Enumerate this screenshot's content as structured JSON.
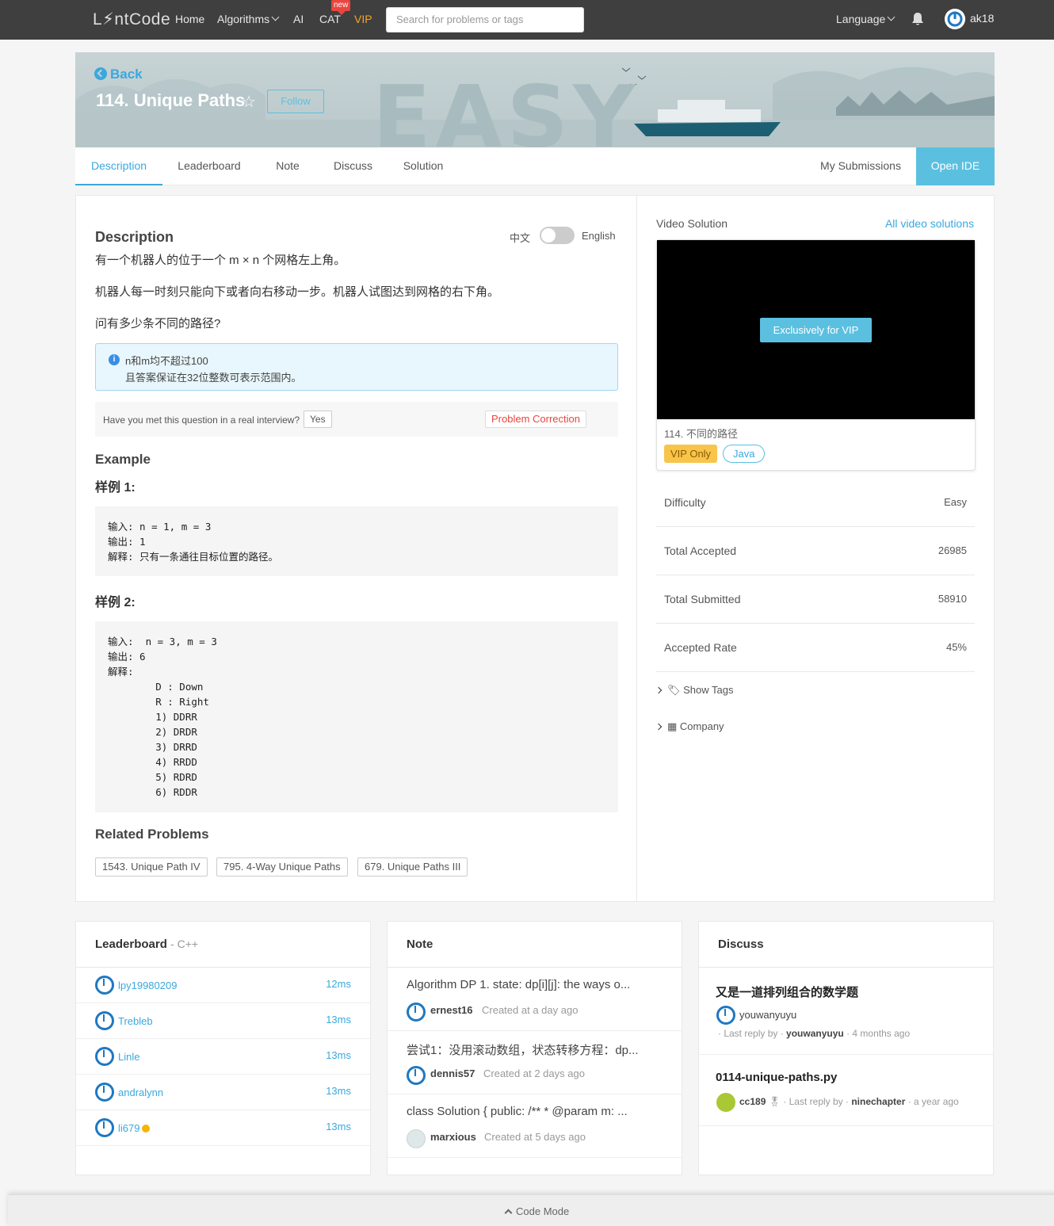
{
  "nav": {
    "logo": "L⚡ntCode",
    "home": "Home",
    "algorithms": "Algorithms",
    "ai": "AI",
    "cat": "CAT",
    "new_badge": "new",
    "vip": "VIP",
    "search_placeholder": "Search for problems or tags",
    "language": "Language",
    "username": "ak18"
  },
  "banner": {
    "back": "Back",
    "title": "114. Unique Paths",
    "follow": "Follow",
    "difficulty_watermark": "EASY"
  },
  "tabs": {
    "description": "Description",
    "leaderboard": "Leaderboard",
    "note": "Note",
    "discuss": "Discuss",
    "solution": "Solution",
    "my_submissions": "My Submissions",
    "open_ide": "Open IDE"
  },
  "problem": {
    "heading": "Description",
    "lang_zh": "中文",
    "lang_en": "English",
    "p1": "有一个机器人的位于一个 m × n 个网格左上角。",
    "p2": "机器人每一时刻只能向下或者向右移动一步。机器人试图达到网格的右下角。",
    "p3": "问有多少条不同的路径?",
    "note_line1": "n和m均不超过100",
    "note_line2": "且答案保证在32位整数可表示范围内。",
    "interview_q": "Have you met this question in a real interview?",
    "yes": "Yes",
    "problem_correction": "Problem Correction",
    "example_heading": "Example",
    "example1_title": "样例 1:",
    "example1_code": "输入: n = 1, m = 3\n输出: 1\n解释: 只有一条通往目标位置的路径。",
    "example2_title": "样例 2:",
    "example2_code": "输入:  n = 3, m = 3\n输出: 6\n解释:\n        D : Down\n        R : Right\n        1) DDRR\n        2) DRDR\n        3) DRRD\n        4) RRDD\n        5) RDRD\n        6) RDDR",
    "related_heading": "Related Problems",
    "related": [
      "1543. Unique Path IV",
      "795. 4-Way Unique Paths",
      "679. Unique Paths III"
    ]
  },
  "sidebar": {
    "video_label": "Video Solution",
    "all_videos": "All video solutions",
    "vip_button": "Exclusively for VIP",
    "video_title": "114. 不同的路径",
    "vip_only": "VIP Only",
    "java": "Java",
    "stats": [
      {
        "k": "Difficulty",
        "v": "Easy"
      },
      {
        "k": "Total Accepted",
        "v": "26985"
      },
      {
        "k": "Total Submitted",
        "v": "58910"
      },
      {
        "k": "Accepted Rate",
        "v": "45%"
      }
    ],
    "show_tags": "Show Tags",
    "company": "Company"
  },
  "leaderboard": {
    "title": "Leaderboard",
    "lang": "- C++",
    "rows": [
      {
        "name": "lpy19980209",
        "time": "12ms"
      },
      {
        "name": "Trebleb",
        "time": "13ms"
      },
      {
        "name": "Linle",
        "time": "13ms"
      },
      {
        "name": "andralynn",
        "time": "13ms"
      },
      {
        "name": "li679",
        "time": "13ms"
      }
    ]
  },
  "notes": {
    "title": "Note",
    "rows": [
      {
        "text": "Algorithm DP 1. state: dp[i][j]: the ways o...",
        "user": "ernest16",
        "time": "Created at a day ago"
      },
      {
        "text": "尝试1：没用滚动数组，状态转移方程：dp...",
        "user": "dennis57",
        "time": "Created at 2 days ago"
      },
      {
        "text": "class Solution { public: /** * @param m: ...",
        "user": "marxious",
        "time": "Created at 5 days ago"
      }
    ]
  },
  "discuss": {
    "title": "Discuss",
    "rows": [
      {
        "title": "又是一道排列组合的数学题",
        "user": "youwanyuyu",
        "last_by_label": "· Last reply by ·",
        "last_by": "youwanyuyu",
        "when": "· 4 months ago"
      },
      {
        "title": "0114-unique-paths.py",
        "user": "cc189",
        "last_by_label": "· Last reply by ·",
        "last_by": "ninechapter",
        "when": "· a year ago"
      }
    ]
  },
  "footer": {
    "code_mode": "Code Mode"
  }
}
